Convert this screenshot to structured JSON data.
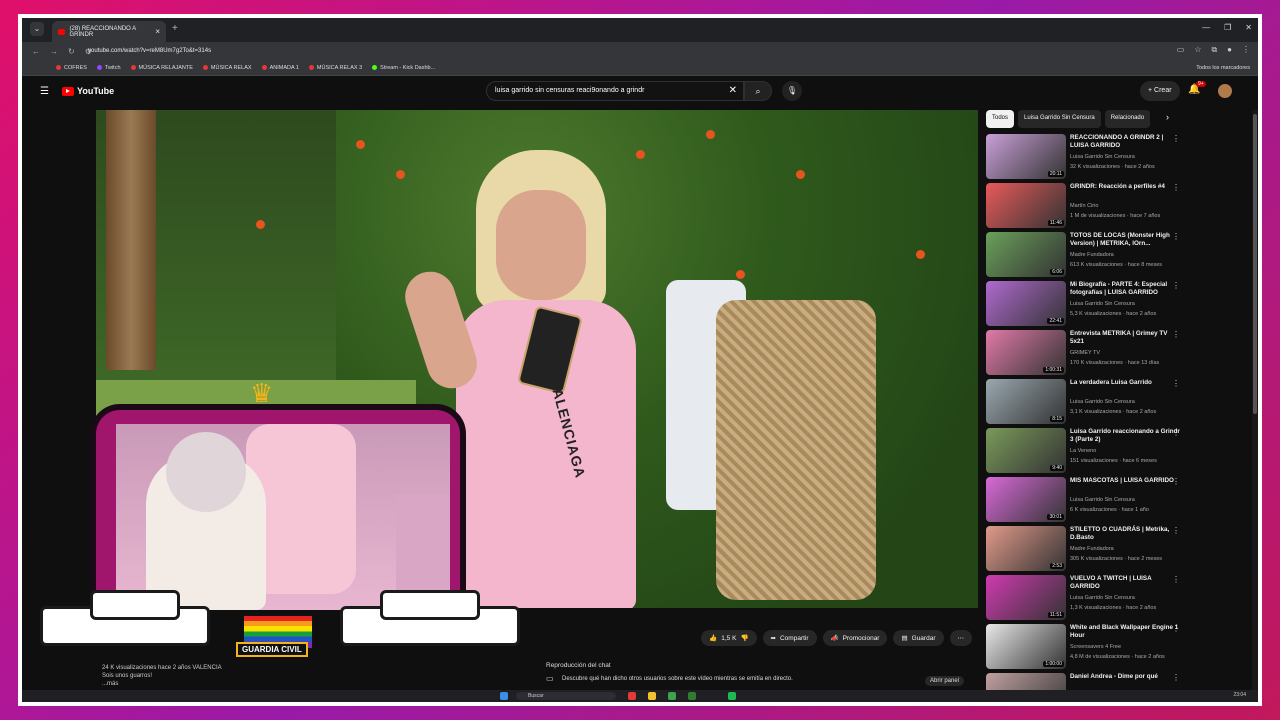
{
  "browser": {
    "tab_title": "(28) REACCIONANDO A GRINDR",
    "url": "youtube.com/watch?v=reM8Um7g2To&t=314s",
    "bookmarks": [
      {
        "label": "COFRES",
        "color": "#e53935"
      },
      {
        "label": "Twitch",
        "color": "#9146ff"
      },
      {
        "label": "MÚSICA RELAJANTE",
        "color": "#e53935"
      },
      {
        "label": "MÚSICA RELAX",
        "color": "#e53935"
      },
      {
        "label": "ANIMADA 1",
        "color": "#e53935"
      },
      {
        "label": "MÚSICA RELAX 3",
        "color": "#e53935"
      },
      {
        "label": "Stream - Kick Dashb...",
        "color": "#53fc18"
      }
    ],
    "all_bookmarks": "Todos los marcadores"
  },
  "youtube": {
    "logo": "YouTube",
    "search_value": "luisa garrido sin censuras reaci9onando a grindr",
    "create_label": "Crear",
    "notif_count": "9+"
  },
  "overlay": {
    "badge_label": "GUARDIA CIVIL"
  },
  "video": {
    "brand_text": "BALENCIAGA",
    "likes": "1,5 K",
    "share_label": "Compartir",
    "promote_label": "Promocionar",
    "save_label": "Guardar",
    "views_line": "24 K visualizaciones  hace 2 años  VALENCIA",
    "desc_line": "Sois unos guarros!",
    "more_label": "...más"
  },
  "chat": {
    "title": "Reproducción del chat",
    "subtitle": "Descubre qué han dicho otros usuarios sobre este vídeo mientras se emitía en directo.",
    "open_label": "Abrir panel"
  },
  "sidebar": {
    "chips": [
      "Todos",
      "Luisa Garrido Sin Censura",
      "Relacionado"
    ],
    "videos": [
      {
        "title": "REACCIONANDO A GRINDR 2 | LUISA GARRIDO",
        "channel": "Luisa Garrido Sin Censura",
        "meta": "32 K visualizaciones · hace 2 años",
        "duration": "20:11",
        "color": "#c9a0d8"
      },
      {
        "title": "GRINDR: Reacción a perfiles #4",
        "channel": "Martín Cirio",
        "meta": "1 M de visualizaciones · hace 7 años",
        "duration": "11:46",
        "color": "#e85a5a"
      },
      {
        "title": "TOTOS DE LOCAS (Monster High Version) | METRIKA, lOrn...",
        "channel": "Madre Fundadora",
        "meta": "613 K visualizaciones · hace 8 meses",
        "duration": "6:06",
        "color": "#6aa05a"
      },
      {
        "title": "Mi Biografía - PARTE 4: Especial fotografías | LUISA GARRIDO",
        "channel": "Luisa Garrido Sin Censura",
        "meta": "5,3 K visualizaciones · hace 2 años",
        "duration": "22:41",
        "color": "#b06ad0"
      },
      {
        "title": "Entrevista METRIKA | Grimey TV 5x21",
        "channel": "GRIMEY TV",
        "meta": "170 K visualizaciones · hace 13 días",
        "duration": "1:00:31",
        "color": "#e27aa8"
      },
      {
        "title": "La verdadera Luisa Garrido",
        "channel": "Luisa Garrido Sin Censura",
        "meta": "3,1 K visualizaciones · hace 2 años",
        "duration": "8:15",
        "color": "#9aa8b0"
      },
      {
        "title": "Luisa Garrido reaccionando a Grindr 3 (Parte 2)",
        "channel": "La Veneno",
        "meta": "151 visualizaciones · hace 6 meses",
        "duration": "9:40",
        "color": "#7a9a5a"
      },
      {
        "title": "MIS MASCOTAS | LUISA GARRIDO",
        "channel": "Luisa Garrido Sin Censura",
        "meta": "6 K visualizaciones · hace 1 año",
        "duration": "30:01",
        "color": "#d86ad8"
      },
      {
        "title": "STILETTO O CUADRÁS | Metrika, D.Basto",
        "channel": "Madre Fundadora",
        "meta": "305 K visualizaciones · hace 2 meses",
        "duration": "2:53",
        "color": "#e29a8a"
      },
      {
        "title": "VUELVO A TWITCH | LUISA GARRIDO",
        "channel": "Luisa Garrido Sin Censura",
        "meta": "1,3 K visualizaciones · hace 2 años",
        "duration": "11:51",
        "color": "#d03ab0"
      },
      {
        "title": "White and Black Wallpaper Engine 1 Hour",
        "channel": "Screensavers 4 Free",
        "meta": "4,8 M de visualizaciones · hace 2 años",
        "duration": "1:00:00",
        "color": "#e8e8e8"
      },
      {
        "title": "Daniel Andrea - Dime por qué",
        "channel": "",
        "meta": "",
        "duration": "",
        "color": "#c0a0a0"
      }
    ]
  },
  "taskbar": {
    "search": "Buscar",
    "time": "23:04"
  }
}
